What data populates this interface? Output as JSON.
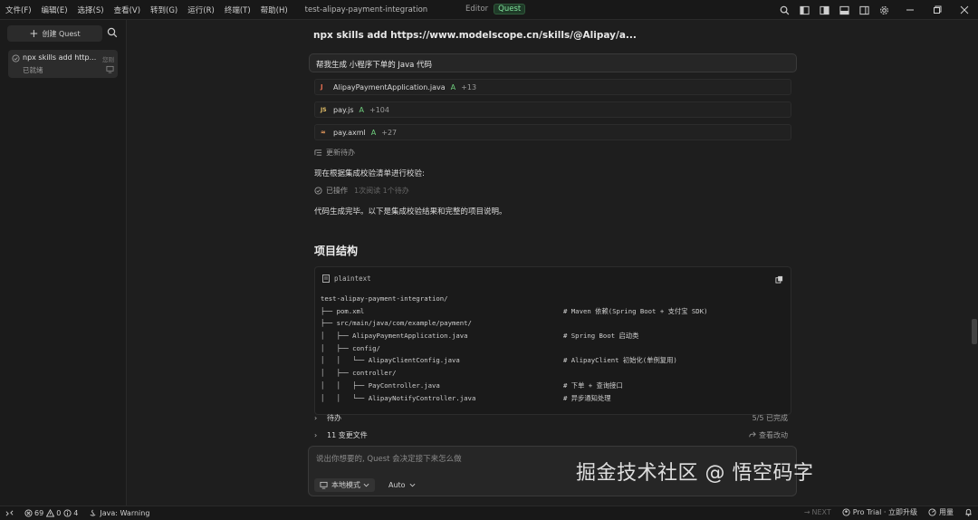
{
  "menubar": {
    "items": [
      "文件(F)",
      "编辑(E)",
      "选择(S)",
      "查看(V)",
      "转到(G)",
      "运行(R)",
      "终端(T)",
      "帮助(H)"
    ],
    "project": "test-alipay-payment-integration",
    "mode_editor": "Editor",
    "mode_quest": "Quest"
  },
  "sidebar": {
    "new_quest": "创建 Quest",
    "quest": {
      "title": "npx skills add http...",
      "badge": "您刚",
      "status": "已就绪"
    }
  },
  "main": {
    "heading": "npx skills add https://www.modelscope.cn/skills/@Alipay/a...",
    "user_message": "帮我生成 小程序下单的 Java 代码",
    "files": [
      {
        "icon": "J",
        "name": "AlipayPaymentApplication.java",
        "tag": "A",
        "add": "+13"
      },
      {
        "icon": "JS",
        "name": "pay.js",
        "tag": "A",
        "add": "+104"
      },
      {
        "icon": "≈",
        "name": "pay.axml",
        "tag": "A",
        "add": "+27"
      }
    ],
    "todo_update": "更新待办",
    "check_text": "现在根据集成校验清单进行校验:",
    "ops_label": "已操作",
    "ops_sub": "1次阅读 1个待办",
    "done_text": "代码生成完毕。以下是集成校验结果和完整的项目说明。",
    "section_title": "项目结构",
    "code": {
      "lang": "plaintext",
      "lines": [
        {
          "tree": "test-alipay-payment-integration/",
          "comment": ""
        },
        {
          "tree": "├── pom.xml",
          "comment": "# Maven 依赖(Spring Boot + 支付宝 SDK)"
        },
        {
          "tree": "├── src/main/java/com/example/payment/",
          "comment": ""
        },
        {
          "tree": "│   ├── AlipayPaymentApplication.java",
          "comment": "# Spring Boot 启动类"
        },
        {
          "tree": "│   ├── config/",
          "comment": ""
        },
        {
          "tree": "│   │   └── AlipayClientConfig.java",
          "comment": "# AlipayClient 初始化(单例复用)"
        },
        {
          "tree": "│   ├── controller/",
          "comment": ""
        },
        {
          "tree": "│   │   ├── PayController.java",
          "comment": "# 下单 + 查询接口"
        },
        {
          "tree": "│   │   └── AlipayNotifyController.java",
          "comment": "# 异步通知处理"
        }
      ]
    },
    "todo_row": {
      "label": "待办",
      "right": "5/5 已完成"
    },
    "changes_row": {
      "label": "11 变更文件",
      "right": "查看改动"
    },
    "input": {
      "placeholder": "说出你想要的, Quest 会决定接下来怎么做",
      "local_mode": "本地模式",
      "auto": "Auto"
    }
  },
  "watermark": "掘金技术社区 @ 悟空码字",
  "statusbar": {
    "errors": "69",
    "warnings": "0",
    "info": "4",
    "java": "Java: Warning",
    "next": "NEXT",
    "pro": "Pro Trial · 立即升级",
    "usage": "用量"
  },
  "colors": {
    "accent_green": "#6fcf7e",
    "java_icon": "#e76f51",
    "js_icon": "#e9c46a",
    "axml_icon": "#f4a261"
  }
}
